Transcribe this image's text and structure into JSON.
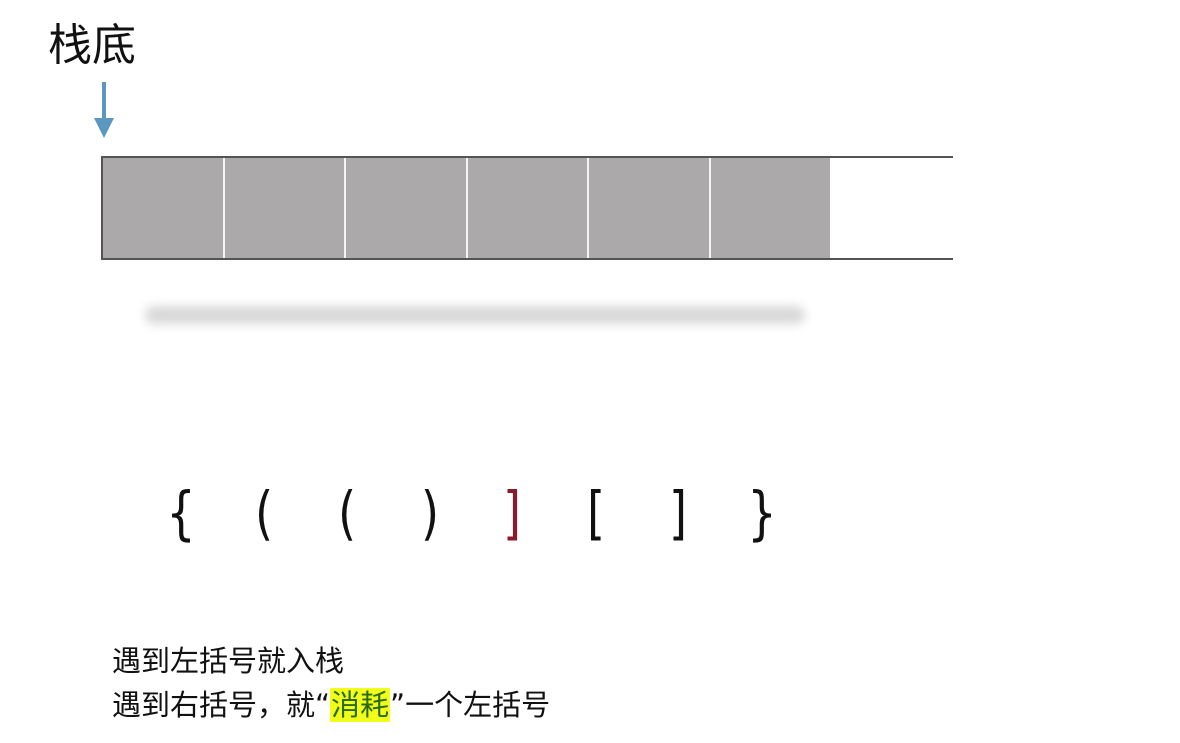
{
  "title": "栈底",
  "arrow_color": "#5b97c0",
  "stack": {
    "filled_cells": 6,
    "cell_color": "#aca9aa"
  },
  "brackets": [
    {
      "char": "{",
      "highlight": false
    },
    {
      "char": "(",
      "highlight": false
    },
    {
      "char": "(",
      "highlight": false
    },
    {
      "char": ")",
      "highlight": false
    },
    {
      "char": "]",
      "highlight": true
    },
    {
      "char": "[",
      "highlight": false
    },
    {
      "char": "]",
      "highlight": false
    },
    {
      "char": "}",
      "highlight": false
    }
  ],
  "highlight_color": "#8b1a2b",
  "notes": {
    "line1": "遇到左括号就入栈",
    "line2_before": "遇到右括号，就“",
    "line2_mark": "消耗",
    "line2_after": "”一个左括号"
  }
}
